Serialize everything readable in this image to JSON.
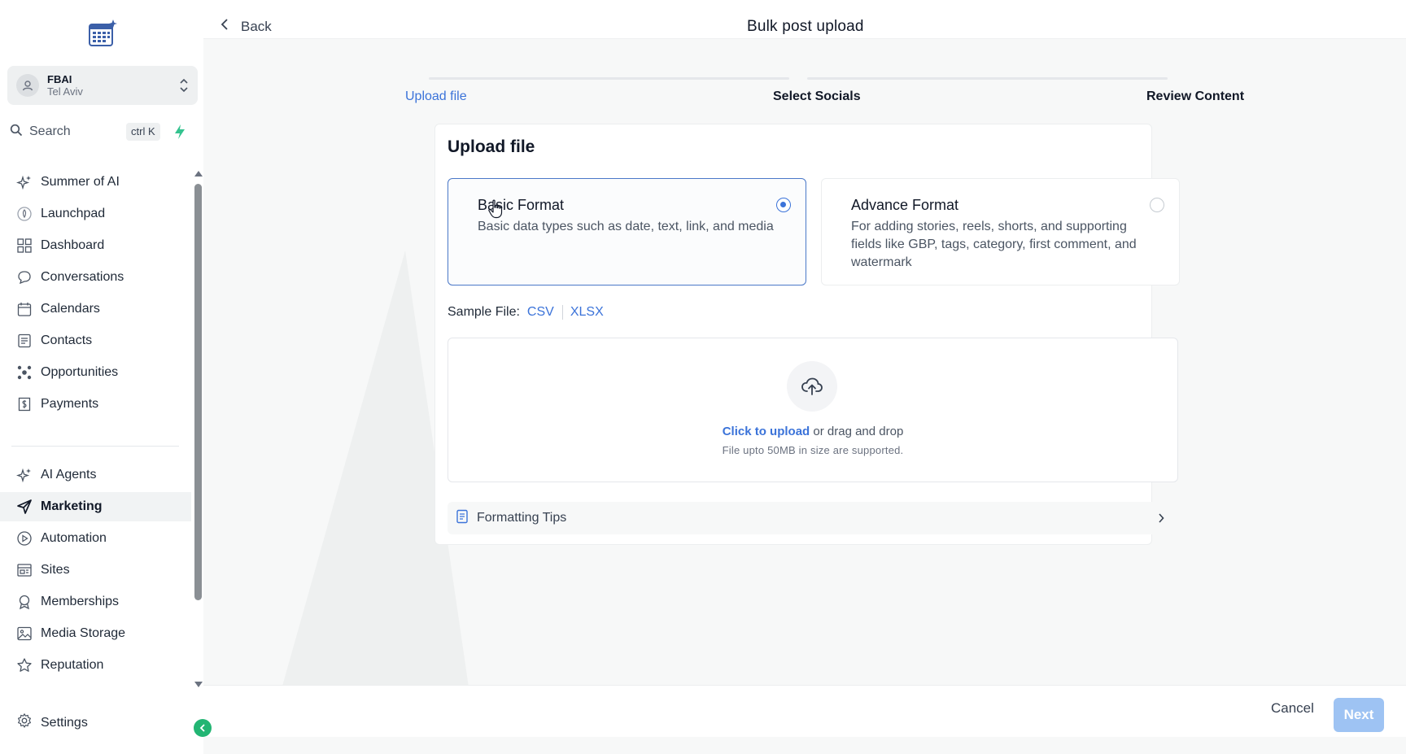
{
  "page": {
    "title": "Bulk post upload",
    "back_label": "Back"
  },
  "account": {
    "name": "FBAI",
    "location": "Tel Aviv"
  },
  "search": {
    "label": "Search",
    "shortcut": "ctrl K"
  },
  "sidebar": {
    "items": [
      {
        "label": "Summer of AI",
        "icon": "sparkle-icon"
      },
      {
        "label": "Launchpad",
        "icon": "rocket-icon"
      },
      {
        "label": "Dashboard",
        "icon": "dashboard-icon"
      },
      {
        "label": "Conversations",
        "icon": "chat-icon"
      },
      {
        "label": "Calendars",
        "icon": "calendar-icon"
      },
      {
        "label": "Contacts",
        "icon": "contacts-icon"
      },
      {
        "label": "Opportunities",
        "icon": "opportunities-icon"
      },
      {
        "label": "Payments",
        "icon": "payments-icon"
      },
      {
        "label": "AI Agents",
        "icon": "sparkle-icon"
      },
      {
        "label": "Marketing",
        "icon": "send-icon",
        "active": true
      },
      {
        "label": "Automation",
        "icon": "play-icon"
      },
      {
        "label": "Sites",
        "icon": "sites-icon"
      },
      {
        "label": "Memberships",
        "icon": "badge-icon"
      },
      {
        "label": "Media Storage",
        "icon": "image-icon"
      },
      {
        "label": "Reputation",
        "icon": "star-icon"
      }
    ],
    "settings_label": "Settings"
  },
  "steps": [
    {
      "label": "Upload file",
      "state": "active"
    },
    {
      "label": "Select Socials",
      "state": "pending"
    },
    {
      "label": "Review Content",
      "state": "pending"
    }
  ],
  "card": {
    "title": "Upload file",
    "formats": [
      {
        "title": "Basic Format",
        "description": "Basic data types such as date, text, link, and media",
        "selected": true
      },
      {
        "title": "Advance Format",
        "description": "For adding stories, reels, shorts, and supporting fields like GBP, tags, category, first comment, and watermark",
        "selected": false
      }
    ],
    "sample": {
      "label": "Sample File:",
      "links": [
        "CSV",
        "XLSX"
      ]
    },
    "upload": {
      "link_text": "Click to upload",
      "rest_text": " or drag and drop",
      "hint": "File upto 50MB in size are supported."
    },
    "tips_label": "Formatting Tips"
  },
  "footer": {
    "cancel_label": "Cancel",
    "next_label": "Next"
  },
  "colors": {
    "accent": "#3b73d9",
    "next_disabled": "#9ec3f3",
    "collapse": "#22b573"
  }
}
